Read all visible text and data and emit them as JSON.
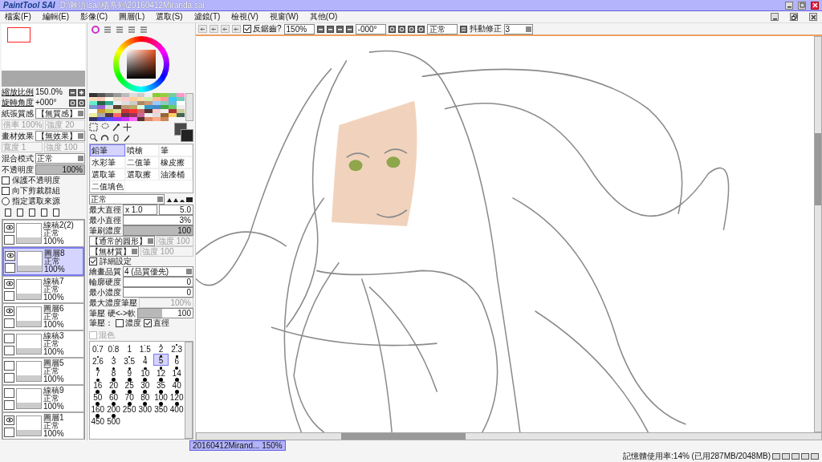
{
  "title_bar": {
    "app": "PaintTool SAI",
    "path": "D:\\雜項\\sai\\櫃系列\\20160412Miranda.sai"
  },
  "menu": [
    "檔案(F)",
    "編輯(E)",
    "影像(C)",
    "圖層(L)",
    "選取(S)",
    "濾鏡(T)",
    "檢視(V)",
    "視窗(W)",
    "其他(O)"
  ],
  "navigator": {
    "zoom_label": "縮放比例",
    "zoom": "150.0%",
    "rotate_label": "旋轉角度",
    "rotate": "+000°"
  },
  "paper": {
    "label": "紙張質感",
    "value": "【無質感】",
    "fields": [
      {
        "label": "倍率",
        "value": "100%",
        "disabled": true
      },
      {
        "label": "強度",
        "value": "20",
        "disabled": true
      }
    ]
  },
  "effect": {
    "label": "畫材效果",
    "value": "【無效果】",
    "fields": [
      {
        "label": "寬度",
        "value": "1",
        "disabled": true
      },
      {
        "label": "強度",
        "value": "100",
        "disabled": true
      }
    ]
  },
  "blend": {
    "label": "混合模式",
    "value": "正常"
  },
  "opacity": {
    "label": "不透明度",
    "level": 1,
    "reading": "100%"
  },
  "layer_options": [
    {
      "kind": "checkbox",
      "label": "保護不透明度",
      "checked": false
    },
    {
      "kind": "checkbox",
      "label": "向下剪裁群組",
      "checked": false
    },
    {
      "kind": "radio",
      "label": "指定選取來源",
      "checked": false
    }
  ],
  "layers": [
    {
      "name": "線稿2(2)",
      "mode": "正常",
      "opacity": "100%",
      "visible": true,
      "selected": false
    },
    {
      "name": "圖層8",
      "mode": "正常",
      "opacity": "100%",
      "visible": true,
      "selected": true
    },
    {
      "name": "線稿7",
      "mode": "正常",
      "opacity": "100%",
      "visible": true,
      "selected": false
    },
    {
      "name": "圖層6",
      "mode": "正常",
      "opacity": "100%",
      "visible": true,
      "selected": false
    },
    {
      "name": "線稿3",
      "mode": "正常",
      "opacity": "100%",
      "visible": false,
      "selected": false
    },
    {
      "name": "圖層5",
      "mode": "正常",
      "opacity": "100%",
      "visible": false,
      "selected": false
    },
    {
      "name": "線稿9",
      "mode": "正常",
      "opacity": "100%",
      "visible": false,
      "selected": false
    },
    {
      "name": "圖層1",
      "mode": "正常",
      "opacity": "100%",
      "visible": true,
      "selected": false
    }
  ],
  "tools": [
    {
      "label": "鉛筆",
      "selected": true
    },
    {
      "label": "噴槍",
      "selected": false
    },
    {
      "label": "筆",
      "selected": false
    },
    {
      "label": "水彩筆",
      "selected": false
    },
    {
      "label": "二值筆",
      "selected": false
    },
    {
      "label": "橡皮擦",
      "selected": false
    },
    {
      "label": "選取筆",
      "selected": false
    },
    {
      "label": "選取擦",
      "selected": false
    },
    {
      "label": "油漆桶",
      "selected": false
    },
    {
      "label": "二值填色",
      "selected": false
    }
  ],
  "brush": {
    "mode": "正常",
    "max_size_label": "最大直徑",
    "max_size_mult": "x 1.0",
    "max_size": "5.0",
    "min_size_label": "最小直徑",
    "min_size": "3%",
    "density": {
      "label": "筆刷濃度",
      "reading": "100",
      "level": 1
    },
    "shape": {
      "value": "【通常的圓形】",
      "strength": "強度 100",
      "disabled": true
    },
    "texture": {
      "value": "【無材質】",
      "strength": "強度 100",
      "disabled": true
    },
    "advanced": {
      "label": "詳細設定",
      "checked": true
    },
    "quality_label": "繪畫品質",
    "quality": "4 (品質優先)",
    "hardness_label": "輪廓硬度",
    "hardness": "0",
    "min_density_label": "最小濃度",
    "min_density": "0",
    "max_pressure": {
      "label": "最大濃度筆壓",
      "value": "100%",
      "disabled": true
    },
    "pressure": {
      "label": "筆壓 硬<->軟",
      "reading": "100",
      "level": 0.45
    },
    "pressure_options_label": "筆壓：",
    "pressure_options": [
      {
        "label": "濃度",
        "checked": false,
        "disabled": false
      },
      {
        "label": "直徑",
        "checked": true,
        "disabled": false
      },
      {
        "label": "混色",
        "checked": false,
        "disabled": true
      }
    ]
  },
  "brush_sizes": [
    {
      "label": "0.7",
      "selected": false
    },
    {
      "label": "0.8",
      "selected": false
    },
    {
      "label": "1",
      "selected": false
    },
    {
      "label": "1.5",
      "selected": false
    },
    {
      "label": "2",
      "selected": false
    },
    {
      "label": "2.3",
      "selected": false
    },
    {
      "label": "2.6",
      "selected": false
    },
    {
      "label": "3",
      "selected": false
    },
    {
      "label": "3.5",
      "selected": false
    },
    {
      "label": "4",
      "selected": false
    },
    {
      "label": "5",
      "selected": true
    },
    {
      "label": "6",
      "selected": false
    },
    {
      "label": "7",
      "selected": false
    },
    {
      "label": "8",
      "selected": false
    },
    {
      "label": "9",
      "selected": false
    },
    {
      "label": "10",
      "selected": false
    },
    {
      "label": "12",
      "selected": false
    },
    {
      "label": "14",
      "selected": false
    },
    {
      "label": "16",
      "selected": false
    },
    {
      "label": "20",
      "selected": false
    },
    {
      "label": "25",
      "selected": false
    },
    {
      "label": "30",
      "selected": false
    },
    {
      "label": "35",
      "selected": false
    },
    {
      "label": "40",
      "selected": false
    },
    {
      "label": "50",
      "selected": false
    },
    {
      "label": "60",
      "selected": false
    },
    {
      "label": "70",
      "selected": false
    },
    {
      "label": "80",
      "selected": false
    },
    {
      "label": "100",
      "selected": false
    },
    {
      "label": "120",
      "selected": false
    },
    {
      "label": "160",
      "selected": false
    },
    {
      "label": "200",
      "selected": false
    },
    {
      "label": "250",
      "selected": false
    },
    {
      "label": "300",
      "selected": false
    },
    {
      "label": "350",
      "selected": false
    },
    {
      "label": "400",
      "selected": false
    },
    {
      "label": "450",
      "selected": false
    },
    {
      "label": "500",
      "selected": false
    }
  ],
  "canvas_toolbar": {
    "antialias": {
      "label": "反鋸齒?",
      "checked": true
    },
    "zoom": "150%",
    "angle": "-000°",
    "mode": "正常",
    "stabilizer_label": "抖動修正",
    "stabilizer": "3"
  },
  "document_tabs": [
    {
      "label": "20160412Mirand... 150%",
      "selected": true
    }
  ],
  "status_bar": {
    "memory": "記憶體使用率:14% (已用287MB/2048MB)"
  }
}
